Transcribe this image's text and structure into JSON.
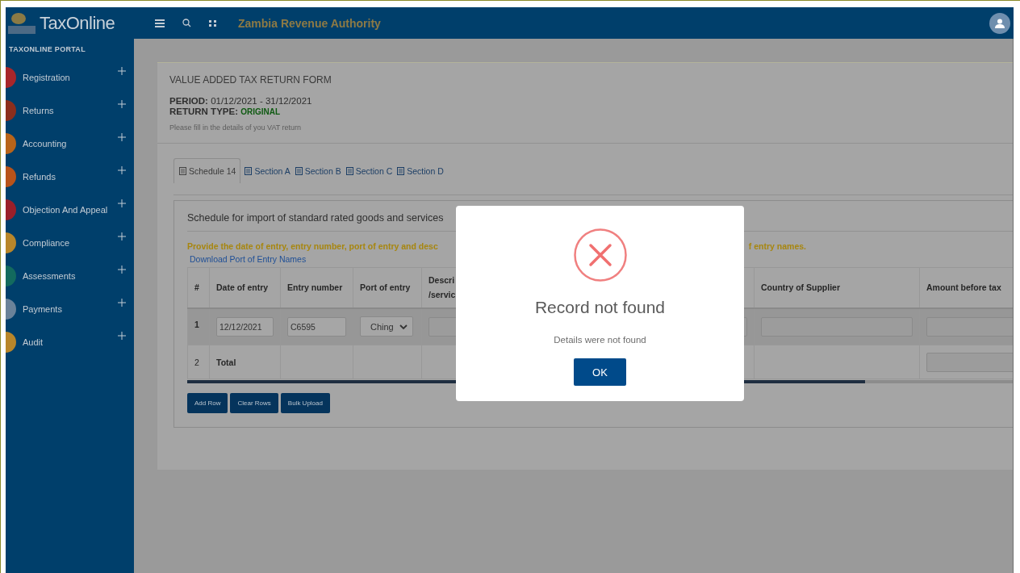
{
  "header": {
    "logo_text": "TaxOnline",
    "title": "Zambia Revenue Authority"
  },
  "sidebar": {
    "heading": "TAXONLINE PORTAL",
    "items": [
      {
        "label": "Registration",
        "color": "#a8262a"
      },
      {
        "label": "Returns",
        "color": "#8c2e1c"
      },
      {
        "label": "Accounting",
        "color": "#b8641a"
      },
      {
        "label": "Refunds",
        "color": "#b8531a"
      },
      {
        "label": "Objection And Appeal",
        "color": "#9a1f2a"
      },
      {
        "label": "Compliance",
        "color": "#b8862a"
      },
      {
        "label": "Assessments",
        "color": "#136a5e"
      },
      {
        "label": "Payments",
        "color": "#6a8299"
      },
      {
        "label": "Audit",
        "color": "#b8862a"
      }
    ]
  },
  "form": {
    "title": "VALUE ADDED TAX RETURN FORM",
    "period_label": "PERIOD:",
    "period": "01/12/2021 - 31/12/2021",
    "return_type_label": "RETURN TYPE:",
    "return_type": "ORIGINAL",
    "hint": "Please fill in the details of you VAT return"
  },
  "tabs": [
    {
      "label": "Schedule 14",
      "selected": true
    },
    {
      "label": "Section A",
      "selected": false
    },
    {
      "label": "Section B",
      "selected": false
    },
    {
      "label": "Section C",
      "selected": false
    },
    {
      "label": "Section D",
      "selected": false
    }
  ],
  "schedule": {
    "title": "Schedule for import of standard rated goods and services",
    "instruction_start": "Provide the date of entry, entry number, port of entry and desc",
    "instruction_end": "f entry names.",
    "download_link": "Download Port of Entry Names",
    "columns": [
      {
        "label": "#"
      },
      {
        "label": "Date of entry"
      },
      {
        "label": "Entry number"
      },
      {
        "label": "Port of entry"
      },
      {
        "label": "Descri",
        "label_2": "/servic"
      },
      {
        "label": "Country of Supplier"
      },
      {
        "label": "Amount before tax"
      }
    ],
    "rows": [
      {
        "cells": [
          {
            "kind": "number",
            "value": "1"
          },
          {
            "kind": "input",
            "value": "12/12/2021"
          },
          {
            "kind": "input",
            "value": "C6595"
          },
          {
            "kind": "select",
            "value": "Ching"
          },
          {
            "kind": "input"
          },
          {
            "kind": "input"
          },
          {
            "kind": "input"
          }
        ]
      },
      {
        "cells": [
          {
            "kind": "number",
            "value": "2"
          },
          {
            "kind": "label",
            "value": "Total"
          },
          {
            "kind": "empty"
          },
          {
            "kind": "empty"
          },
          {
            "kind": "empty"
          },
          {
            "kind": "empty"
          },
          {
            "kind": "input"
          }
        ]
      }
    ],
    "buttons": [
      "Add Row",
      "Clear Rows",
      "Bulk Upload"
    ]
  },
  "dialog": {
    "title": "Record not found",
    "message": "Details were not found",
    "button": "OK"
  }
}
